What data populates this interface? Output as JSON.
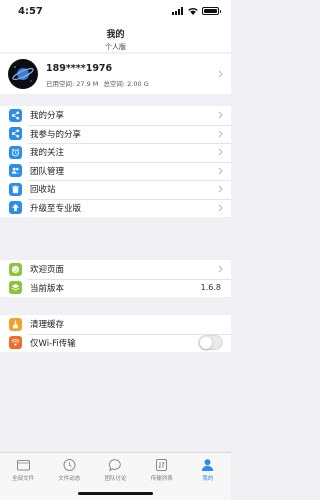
{
  "status": {
    "time": "4:57"
  },
  "nav": {
    "title": "我的",
    "subtitle": "个人版"
  },
  "profile": {
    "phone": "189****1976",
    "used": "已用空间: 27.9 M",
    "total": "总空间: 2.00 G"
  },
  "group1": [
    {
      "label": "我的分享",
      "icon": "share-icon",
      "color": "#2d8ee8"
    },
    {
      "label": "我参与的分享",
      "icon": "share-icon",
      "color": "#2d8ee8"
    },
    {
      "label": "我的关注",
      "icon": "alarm-icon",
      "color": "#2d8ee8"
    },
    {
      "label": "团队管理",
      "icon": "team-icon",
      "color": "#2d8ee8"
    },
    {
      "label": "回收站",
      "icon": "trash-icon",
      "color": "#2d8ee8"
    },
    {
      "label": "升级至专业版",
      "icon": "upgrade-icon",
      "color": "#2d8ee8"
    }
  ],
  "group2": [
    {
      "label": "欢迎页面",
      "icon": "smile-icon",
      "color": "#8cc43d"
    },
    {
      "label": "当前版本",
      "icon": "layers-icon",
      "color": "#8cc43d",
      "value": "1.6.8"
    }
  ],
  "group3": [
    {
      "label": "清理缓存",
      "icon": "broom-icon",
      "color": "#f3a12e"
    },
    {
      "label": "仅Wi-Fi传输",
      "icon": "wifi-icon",
      "color": "#f06a2a",
      "toggle": false
    }
  ],
  "tabs": [
    {
      "label": "全部文件",
      "icon": "folder-icon",
      "active": false
    },
    {
      "label": "文件动态",
      "icon": "clock-icon",
      "active": false
    },
    {
      "label": "团队讨论",
      "icon": "chat-icon",
      "active": false
    },
    {
      "label": "传输列表",
      "icon": "transfer-icon",
      "active": false
    },
    {
      "label": "我的",
      "icon": "user-icon",
      "active": true
    }
  ]
}
